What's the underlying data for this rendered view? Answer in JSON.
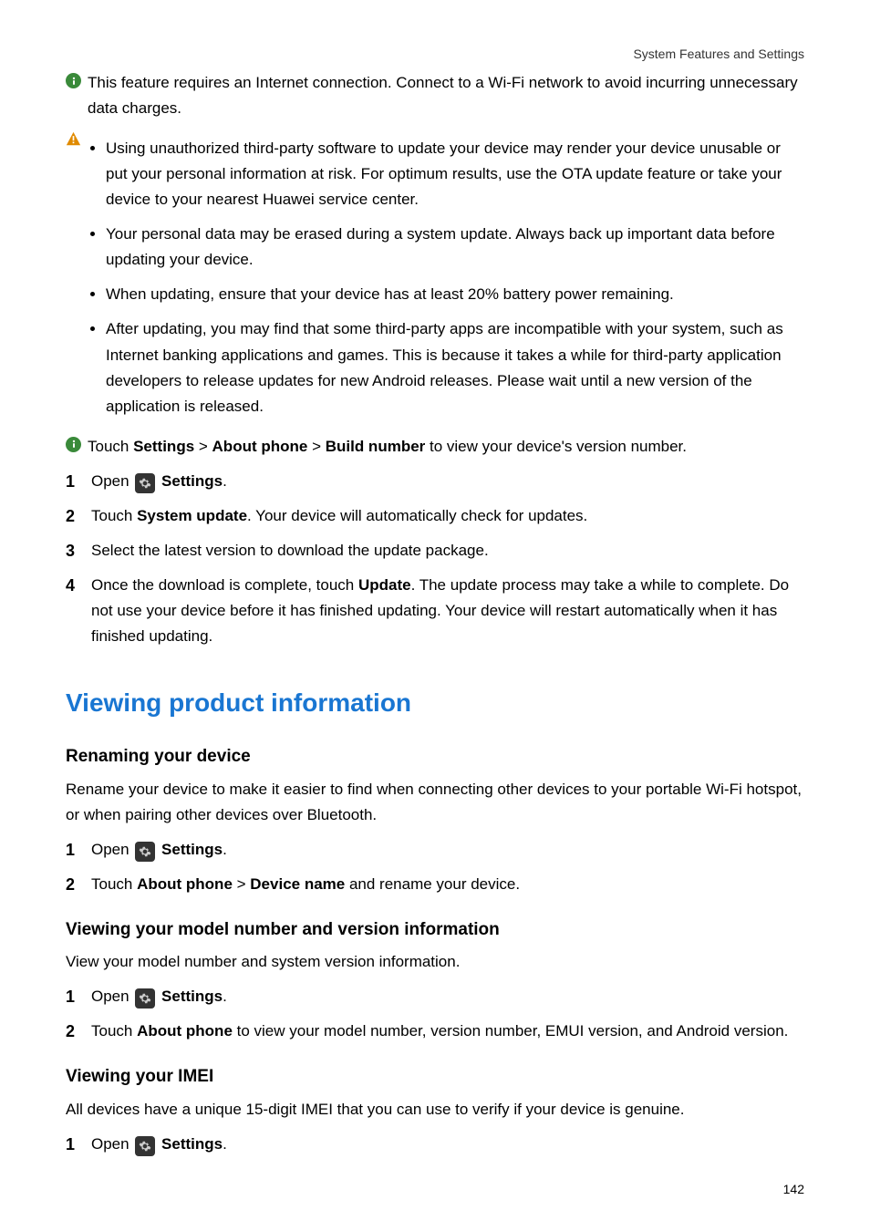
{
  "header": "System Features and Settings",
  "info1": "This feature requires an Internet connection. Connect to a Wi-Fi network to avoid incurring unnecessary data charges.",
  "warnBullets": [
    "Using unauthorized third-party software to update your device may render your device unusable or put your personal information at risk. For optimum results, use the OTA update feature or take your device to your nearest Huawei service center.",
    "Your personal data may be erased during a system update. Always back up important data before updating your device.",
    "When updating, ensure that your device has at least 20% battery power remaining.",
    "After updating, you may find that some third-party apps are incompatible with your system, such as Internet banking applications and games. This is because it takes a while for third-party application developers to release updates for new Android releases. Please wait until a new version of the application is released."
  ],
  "info2": {
    "pre": "Touch ",
    "settings": "Settings",
    "gt1": " > ",
    "about": "About phone",
    "gt2": " > ",
    "build": "Build number",
    "post": " to view your device's version number."
  },
  "stepsA": {
    "s1_pre": "Open ",
    "s1_bold": "Settings",
    "s1_post": ".",
    "s2_pre": "Touch ",
    "s2_bold": "System update",
    "s2_post": ". Your device will automatically check for updates.",
    "s3": "Select the latest version to download the update package.",
    "s4_pre": "Once the download is complete, touch ",
    "s4_bold": "Update",
    "s4_post": ". The update process may take a while to complete. Do not use your device before it has finished updating. Your device will restart automatically when it has finished updating."
  },
  "h1": "Viewing product information",
  "rename": {
    "title": "Renaming your device",
    "intro": "Rename your device to make it easier to find when connecting other devices to your portable Wi-Fi hotspot, or when pairing other devices over Bluetooth.",
    "s1_pre": "Open ",
    "s1_bold": "Settings",
    "s1_post": ".",
    "s2_pre": "Touch ",
    "s2_b1": "About phone",
    "s2_gt": " > ",
    "s2_b2": "Device name",
    "s2_post": " and rename your device."
  },
  "model": {
    "title": "Viewing your model number and version information",
    "intro": "View your model number and system version information.",
    "s1_pre": "Open ",
    "s1_bold": "Settings",
    "s1_post": ".",
    "s2_pre": "Touch ",
    "s2_bold": "About phone",
    "s2_post": " to view your model number, version number, EMUI version, and Android version."
  },
  "imei": {
    "title": "Viewing your IMEI",
    "intro": "All devices have a unique 15-digit IMEI that you can use to verify if your device is genuine.",
    "s1_pre": "Open ",
    "s1_bold": "Settings",
    "s1_post": "."
  },
  "pageNumber": "142"
}
